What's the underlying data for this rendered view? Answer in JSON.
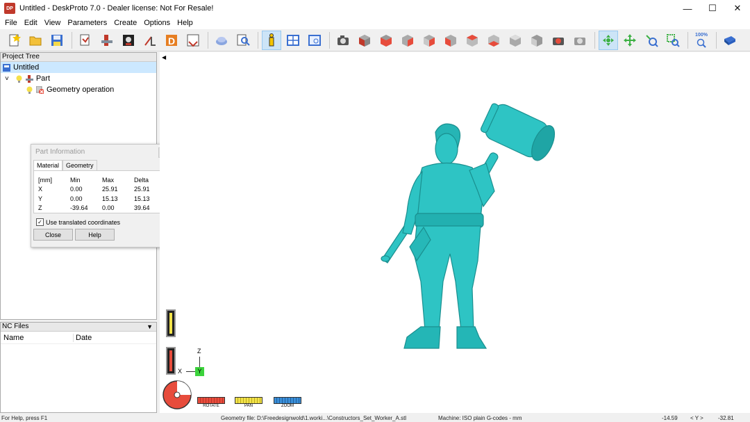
{
  "window": {
    "title": "Untitled - DeskProto 7.0 - Dealer license: Not For Resale!",
    "app_icon_text": "DP"
  },
  "menu": [
    "File",
    "Edit",
    "View",
    "Parameters",
    "Create",
    "Options",
    "Help"
  ],
  "toolbar": {
    "zoom_label": "100%"
  },
  "project_tree": {
    "header": "Project Tree",
    "items": [
      {
        "label": "Untitled"
      },
      {
        "label": "Part"
      },
      {
        "label": "Geometry operation"
      }
    ]
  },
  "nc_files": {
    "header": "NC Files",
    "columns": [
      "Name",
      "Date"
    ]
  },
  "part_info": {
    "title": "Part Information",
    "tabs": [
      "Material",
      "Geometry"
    ],
    "headers": [
      "[mm]",
      "Min",
      "Max",
      "Delta"
    ],
    "rows": [
      [
        "X",
        "0.00",
        "25.91",
        "25.91"
      ],
      [
        "Y",
        "0.00",
        "15.13",
        "15.13"
      ],
      [
        "Z",
        "-39.64",
        "0.00",
        "39.64"
      ]
    ],
    "checkbox_label": "Use translated coordinates",
    "checkbox_checked": true,
    "close_label": "Close",
    "help_label": "Help"
  },
  "axes": {
    "z": "Z",
    "x": "X",
    "y": "Y"
  },
  "view_buttons": {
    "rotate": "ROTATE",
    "pan": "PAN",
    "zoom": "ZOOM"
  },
  "status": {
    "help": "For Help, press F1",
    "geometry_file": "Geometry file: D:\\Freedesignwold\\1.worki...\\Constructors_Set_Worker_A.stl",
    "machine": "Machine: ISO plain G-codes - mm",
    "coord1": "-14.59",
    "coord_axis": "< Y >",
    "coord2": "-32.81"
  },
  "colors": {
    "model": "#2ec4c4",
    "model_shade": "#1a8f8f",
    "accent_select": "#cce8ff",
    "toolbar_active": "#cce4f7"
  }
}
